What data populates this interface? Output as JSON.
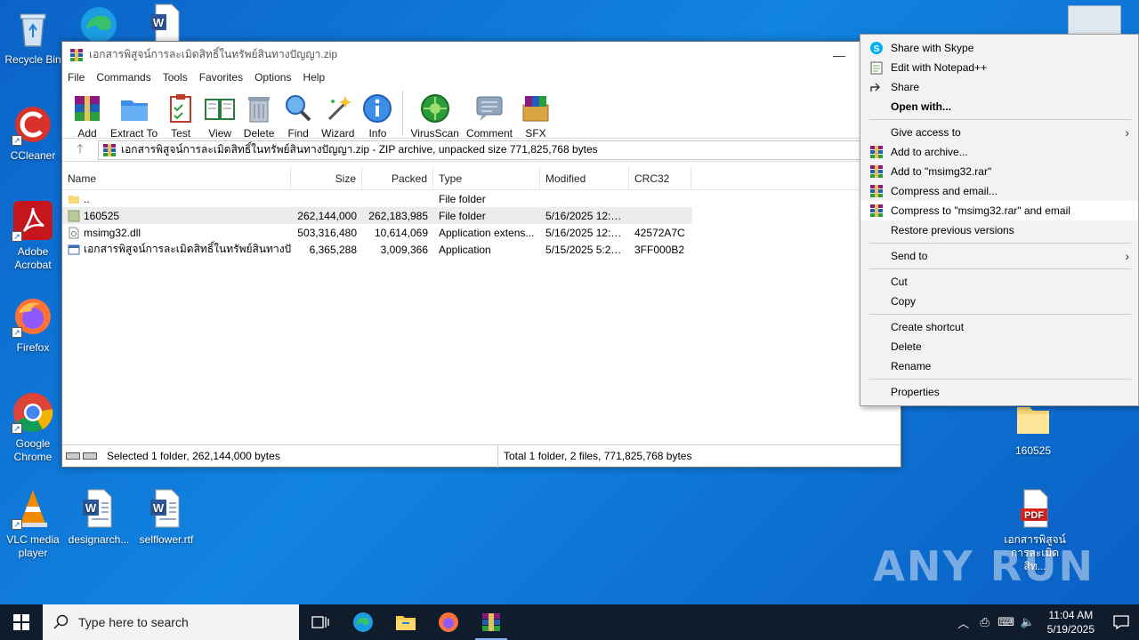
{
  "desktop": {
    "icons": [
      {
        "label": "Recycle Bin"
      },
      {
        "label": "CCleaner"
      },
      {
        "label": "Adobe Acrobat"
      },
      {
        "label": "Firefox"
      },
      {
        "label": "Google Chrome"
      },
      {
        "label": "VLC media player"
      },
      {
        "label": "designarch..."
      },
      {
        "label": "selflower.rtf"
      },
      {
        "label": "160525"
      },
      {
        "label": "เอกสารพิสูจน์การละเมิดสิท..."
      }
    ],
    "watermark": "ANY RUN"
  },
  "window": {
    "title": "เอกสารพิสูจน์การละเมิดสิทธิ์ในทรัพย์สินทางปัญญา.zip",
    "menu": [
      "File",
      "Commands",
      "Tools",
      "Favorites",
      "Options",
      "Help"
    ],
    "toolbar": [
      "Add",
      "Extract To",
      "Test",
      "View",
      "Delete",
      "Find",
      "Wizard",
      "Info",
      "VirusScan",
      "Comment",
      "SFX"
    ],
    "address": "เอกสารพิสูจน์การละเมิดสิทธิ์ในทรัพย์สินทางปัญญา.zip - ZIP archive, unpacked size 771,825,768 bytes",
    "columns": {
      "name": "Name",
      "size": "Size",
      "packed": "Packed",
      "type": "Type",
      "modified": "Modified",
      "crc": "CRC32"
    },
    "rows": [
      {
        "name": "..",
        "size": "",
        "packed": "",
        "type": "File folder",
        "modified": "",
        "crc": ""
      },
      {
        "name": "160525",
        "size": "262,144,000",
        "packed": "262,183,985",
        "type": "File folder",
        "modified": "5/16/2025 12:0...",
        "crc": ""
      },
      {
        "name": "msimg32.dll",
        "size": "503,316,480",
        "packed": "10,614,069",
        "type": "Application extens...",
        "modified": "5/16/2025 12:0...",
        "crc": "42572A7C"
      },
      {
        "name": "เอกสารพิสูจน์การละเมิดสิทธิ์ในทรัพย์สินทางปัญญา...",
        "size": "6,365,288",
        "packed": "3,009,366",
        "type": "Application",
        "modified": "5/15/2025 5:23 ...",
        "crc": "3FF000B2"
      }
    ],
    "status_left": "Selected 1 folder, 262,144,000 bytes",
    "status_right": "Total 1 folder, 2 files, 771,825,768 bytes"
  },
  "context_menu": {
    "items": [
      "Share with Skype",
      "Edit with Notepad++",
      "Share",
      "Open with...",
      "Give access to",
      "Add to archive...",
      "Add to \"msimg32.rar\"",
      "Compress and email...",
      "Compress to \"msimg32.rar\" and email",
      "Restore previous versions",
      "Send to",
      "Cut",
      "Copy",
      "Create shortcut",
      "Delete",
      "Rename",
      "Properties"
    ]
  },
  "taskbar": {
    "search_placeholder": "Type here to search",
    "time": "11:04 AM",
    "date": "5/19/2025"
  },
  "colors": {
    "desktop_bg": "#0b63c8",
    "taskbar_bg": "#101c2c",
    "menu_bg": "#f2f2f2",
    "selection": "#ececec"
  }
}
